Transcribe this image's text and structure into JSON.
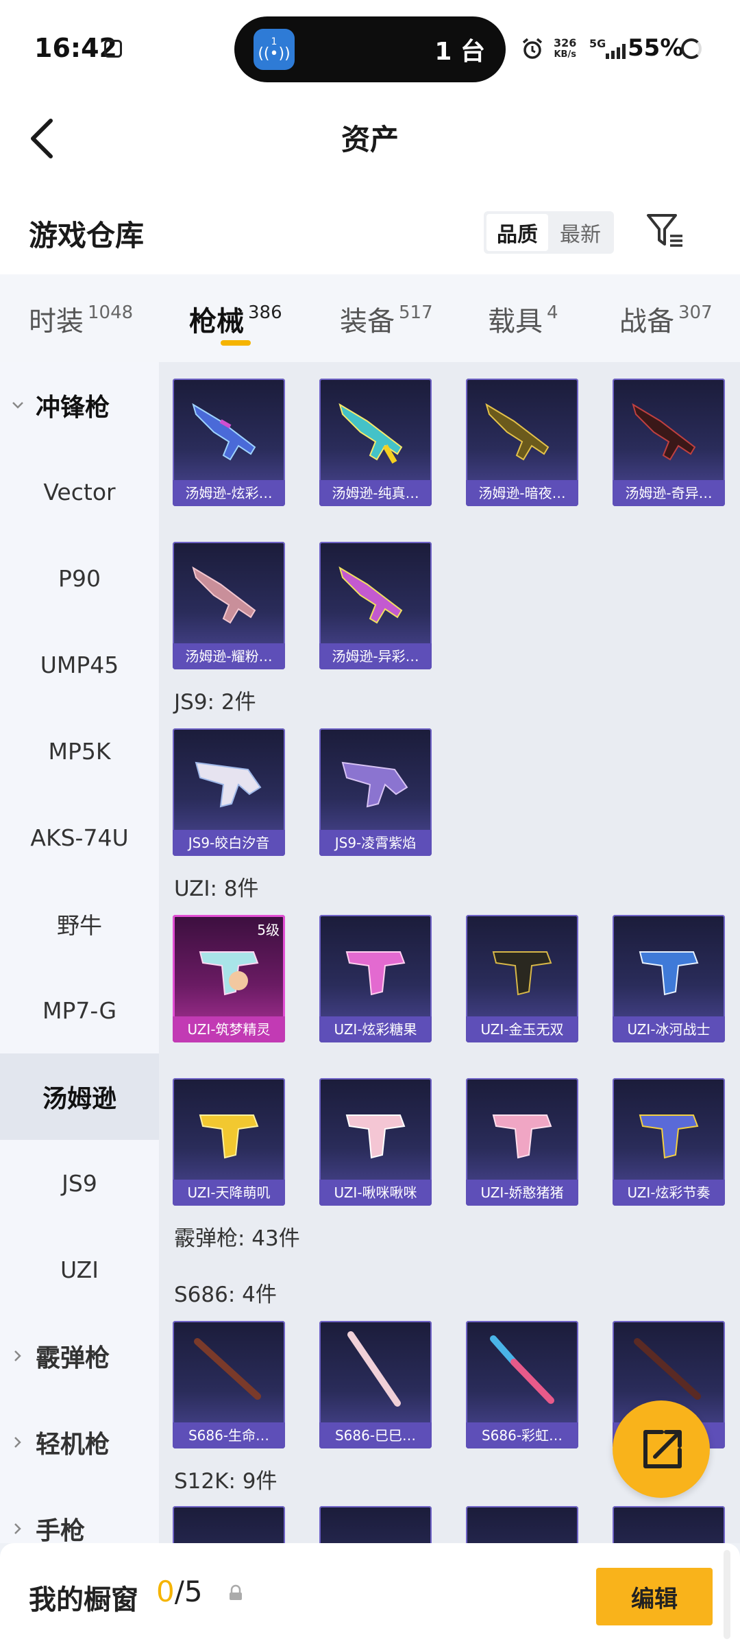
{
  "status_bar": {
    "time": "16:42",
    "pill_app_badge": "1",
    "pill_text": "1 台",
    "net_speed": "326",
    "net_unit": "KB/s",
    "network": "5G",
    "battery": "55%"
  },
  "header": {
    "title": "资产"
  },
  "warehouse": {
    "title": "游戏仓库",
    "sort_options": [
      "品质",
      "最新"
    ],
    "sort_selected": "品质"
  },
  "tabs": [
    {
      "label": "时装",
      "count": "1048"
    },
    {
      "label": "枪械",
      "count": "386"
    },
    {
      "label": "装备",
      "count": "517"
    },
    {
      "label": "载具",
      "count": "4"
    },
    {
      "label": "战备",
      "count": "307"
    }
  ],
  "active_tab": "枪械",
  "sidebar": {
    "items": [
      {
        "label": "冲锋枪"
      },
      {
        "label": "Vector"
      },
      {
        "label": "P90"
      },
      {
        "label": "UMP45"
      },
      {
        "label": "MP5K"
      },
      {
        "label": "AKS-74U"
      },
      {
        "label": "野牛"
      },
      {
        "label": "MP7-G"
      },
      {
        "label": "汤姆逊"
      },
      {
        "label": "JS9"
      },
      {
        "label": "UZI"
      },
      {
        "label": "霰弹枪"
      },
      {
        "label": "轻机枪"
      },
      {
        "label": "手枪"
      }
    ],
    "selected": "汤姆逊"
  },
  "content": {
    "tommy_row1": [
      "汤姆逊-炫彩…",
      "汤姆逊-纯真…",
      "汤姆逊-暗夜…",
      "汤姆逊-奇异…"
    ],
    "tommy_row2": [
      "汤姆逊-耀粉…",
      "汤姆逊-异彩…"
    ],
    "js9_header": "JS9: 2件",
    "js9_items": [
      "JS9-皎白汐音",
      "JS9-凌霄紫焰"
    ],
    "uzi_header": "UZI: 8件",
    "uzi_row1": [
      "UZI-筑梦精灵",
      "UZI-炫彩糖果",
      "UZI-金玉无双",
      "UZI-冰河战士"
    ],
    "uzi_level_badge": "5级",
    "uzi_row2": [
      "UZI-天降萌叽",
      "UZI-啾咪啾咪",
      "UZI-娇憨猪猪",
      "UZI-炫彩节奏"
    ],
    "shotgun_header": "霰弹枪: 43件",
    "s686_header": "S686: 4件",
    "s686_items": [
      "S686-生命…",
      "S686-巳巳…",
      "S686-彩虹…",
      ""
    ],
    "s12k_header": "S12K: 9件"
  },
  "colors": {
    "accent": "#f9b31b",
    "tab_underline": "#f5b400",
    "card_label": "#5e4fb8",
    "card_legendary": "#c23ab4"
  },
  "bottom_bar": {
    "label": "我的橱窗",
    "count_used": "0",
    "count_total": "/5",
    "edit_label": "编辑"
  },
  "icons": {
    "back": "chevron-left-icon",
    "filter": "filter-icon",
    "share": "external-link-icon",
    "lock": "lock-icon"
  }
}
